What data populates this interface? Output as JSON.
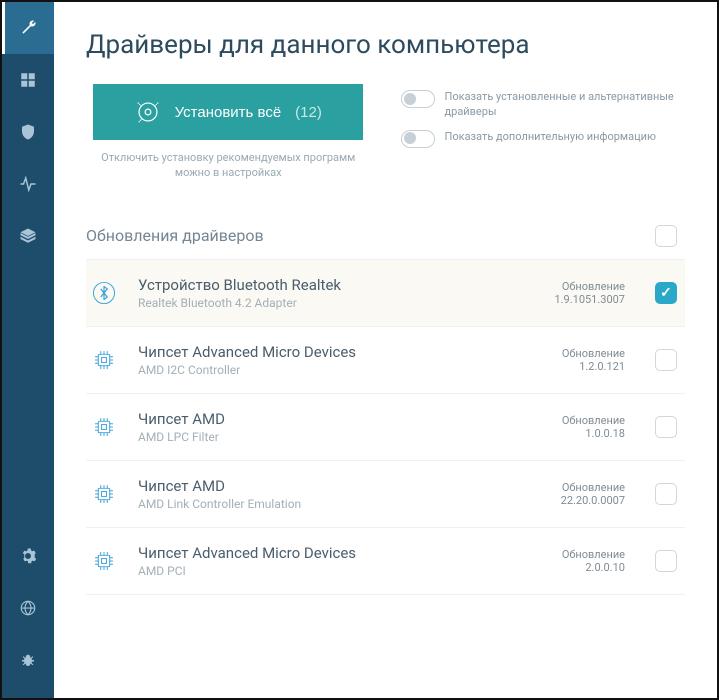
{
  "page_title": "Драйверы для данного компьютера",
  "install": {
    "label": "Установить всё",
    "count": "(12)",
    "hint": "Отключить установку рекомендуемых программ можно в настройках"
  },
  "toggles": {
    "installed": "Показать установленные и альтернативные драйверы",
    "extra": "Показать дополнительную информацию"
  },
  "section_title": "Обновления драйверов",
  "status_label": "Обновление",
  "drivers": [
    {
      "name": "Устройство Bluetooth Realtek",
      "sub": "Realtek Bluetooth 4.2 Adapter",
      "version": "1.9.1051.3007",
      "checked": true,
      "icon": "bluetooth"
    },
    {
      "name": "Чипсет Advanced Micro Devices",
      "sub": "AMD I2C Controller",
      "version": "1.2.0.121",
      "checked": false,
      "icon": "chip"
    },
    {
      "name": "Чипсет AMD",
      "sub": "AMD LPC Filter",
      "version": "1.0.0.18",
      "checked": false,
      "icon": "chip"
    },
    {
      "name": "Чипсет AMD",
      "sub": "AMD Link Controller Emulation",
      "version": "22.20.0.0007",
      "checked": false,
      "icon": "chip"
    },
    {
      "name": "Чипсет Advanced Micro Devices",
      "sub": "AMD PCI",
      "version": "2.0.0.10",
      "checked": false,
      "icon": "chip"
    }
  ]
}
